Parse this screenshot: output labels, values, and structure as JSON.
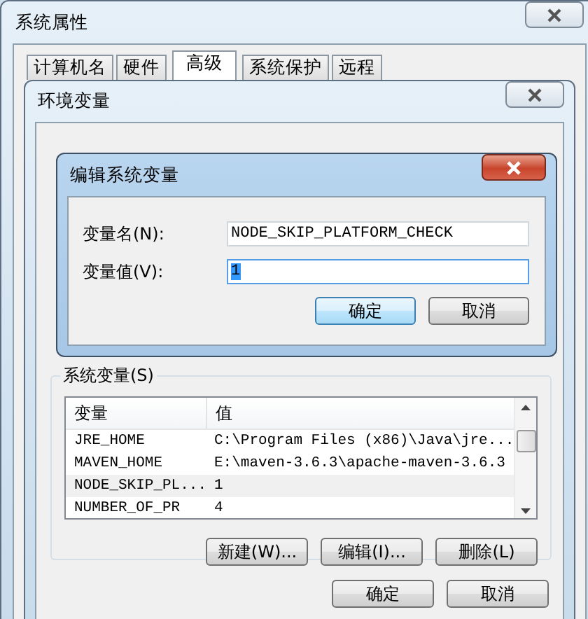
{
  "system_properties": {
    "title": "系统属性",
    "tabs": [
      {
        "label": "计算机名",
        "selected": false
      },
      {
        "label": "硬件",
        "selected": false
      },
      {
        "label": "高级",
        "selected": true
      },
      {
        "label": "系统保护",
        "selected": false
      },
      {
        "label": "远程",
        "selected": false
      }
    ]
  },
  "env_window": {
    "title": "环境变量",
    "group_label": "系统变量(S)",
    "columns": [
      "变量",
      "值"
    ],
    "rows": [
      {
        "name": "JRE_HOME",
        "value": "C:\\Program Files (x86)\\Java\\jre...",
        "selected": false
      },
      {
        "name": "MAVEN_HOME",
        "value": "E:\\maven-3.6.3\\apache-maven-3.6.3",
        "selected": false
      },
      {
        "name": "NODE_SKIP_PL...",
        "value": "1",
        "selected": true
      },
      {
        "name": "NUMBER_OF_PR",
        "value": "4",
        "selected": false
      }
    ],
    "list_buttons": [
      "新建(W)...",
      "编辑(I)...",
      "删除(L)"
    ],
    "buttons": [
      {
        "label": "确定",
        "default": false
      },
      {
        "label": "取消",
        "default": false
      }
    ]
  },
  "edit_dialog": {
    "title": "编辑系统变量",
    "fields": [
      {
        "label": "变量名(N):",
        "value": "NODE_SKIP_PLATFORM_CHECK",
        "focused": false
      },
      {
        "label": "变量值(V):",
        "value": "1",
        "focused": true
      }
    ],
    "buttons": [
      {
        "label": "确定",
        "default": true
      },
      {
        "label": "取消",
        "default": false
      }
    ]
  }
}
